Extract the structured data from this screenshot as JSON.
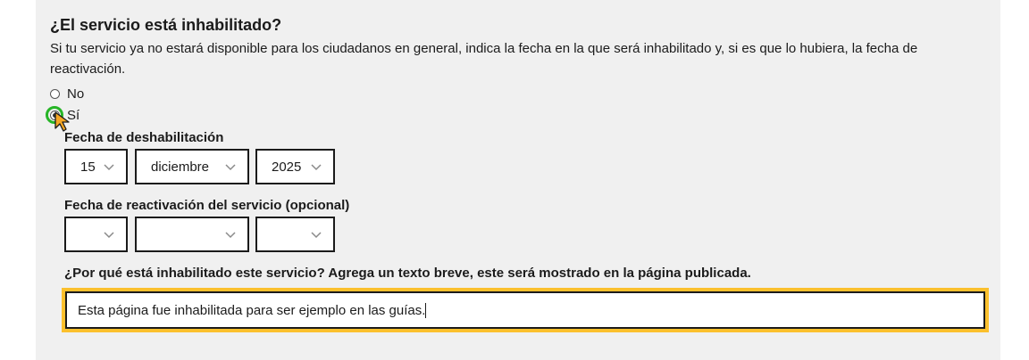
{
  "section": {
    "title": "¿El servicio está inhabilitado?",
    "description": "Si tu servicio ya no estará disponible para los ciudadanos en general, indica la fecha en la que será inhabilitado y, si es que lo hubiera, la fecha de reactivación."
  },
  "radio_options": [
    {
      "label": "No",
      "checked": false
    },
    {
      "label": "Sí",
      "checked": true
    }
  ],
  "disable_date": {
    "label": "Fecha de deshabilitación",
    "day": "15",
    "month": "diciembre",
    "year": "2025"
  },
  "reactivation_date": {
    "label": "Fecha de reactivación del servicio (opcional)",
    "day": "",
    "month": "",
    "year": ""
  },
  "reason": {
    "label": "¿Por qué está inhabilitado este servicio? Agrega un texto breve, este será mostrado en la página publicada.",
    "value": "Esta página fue inhabilitada para ser ejemplo en las guías."
  },
  "colors": {
    "panel_bg": "#f0f0f0",
    "focus_outline": "#fbc02d",
    "cursor_ring": "#27b527",
    "cursor_fill": "#f6a623"
  },
  "icons": {
    "select_chevron": "chevron-down-icon",
    "mouse_pointer": "mouse-pointer-icon"
  }
}
